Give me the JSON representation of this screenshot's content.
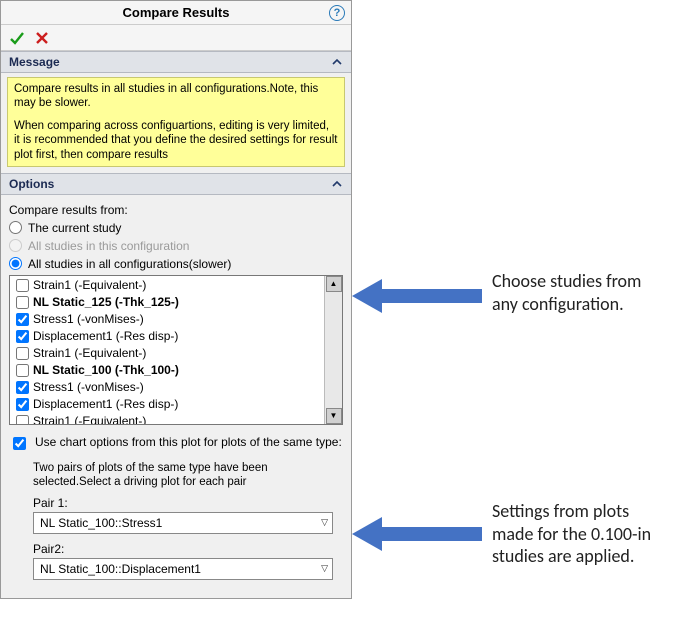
{
  "title": "Compare Results",
  "message": {
    "header": "Message",
    "p1": "Compare results in all studies in all configurations.Note, this may be slower.",
    "p2": "When comparing across configuartions, editing is very limited, it is recommended that you define the desired settings for result plot first, then compare results"
  },
  "options": {
    "header": "Options",
    "compare_from_label": "Compare results from:",
    "radio_current": "The current study",
    "radio_all_config": "All studies in this configuration",
    "radio_all_studies": "All studies in all configurations(slower)",
    "list": {
      "rows": [
        {
          "type": "item",
          "checked": false,
          "label": "Strain1 (-Equivalent-)"
        },
        {
          "type": "group",
          "checked": false,
          "label": "NL Static_125 (-Thk_125-)"
        },
        {
          "type": "item",
          "checked": true,
          "label": "Stress1 (-vonMises-)"
        },
        {
          "type": "item",
          "checked": true,
          "label": "Displacement1 (-Res disp-)"
        },
        {
          "type": "item",
          "checked": false,
          "label": "Strain1 (-Equivalent-)"
        },
        {
          "type": "group",
          "checked": false,
          "label": "NL Static_100 (-Thk_100-)"
        },
        {
          "type": "item",
          "checked": true,
          "label": "Stress1 (-vonMises-)"
        },
        {
          "type": "item",
          "checked": true,
          "label": "Displacement1 (-Res disp-)"
        },
        {
          "type": "item",
          "checked": false,
          "label": "Strain1 (-Equivalent-)"
        }
      ]
    },
    "use_chart_options_label": "Use chart options from this plot for plots of the same type:",
    "pair_note": "Two pairs of plots of the same type have been selected.Select a driving plot for each pair",
    "pair1_label": "Pair 1:",
    "pair1_value": "NL Static_100::Stress1",
    "pair2_label": "Pair2:",
    "pair2_value": "NL Static_100::Displacement1"
  },
  "annotations": {
    "a1_l1": "Choose studies from",
    "a1_l2": "any configuration.",
    "a2_l1": "Settings from plots",
    "a2_l2": "made for the 0.100-in",
    "a2_l3": "studies are applied."
  },
  "colors": {
    "arrow": "#4472c4"
  }
}
